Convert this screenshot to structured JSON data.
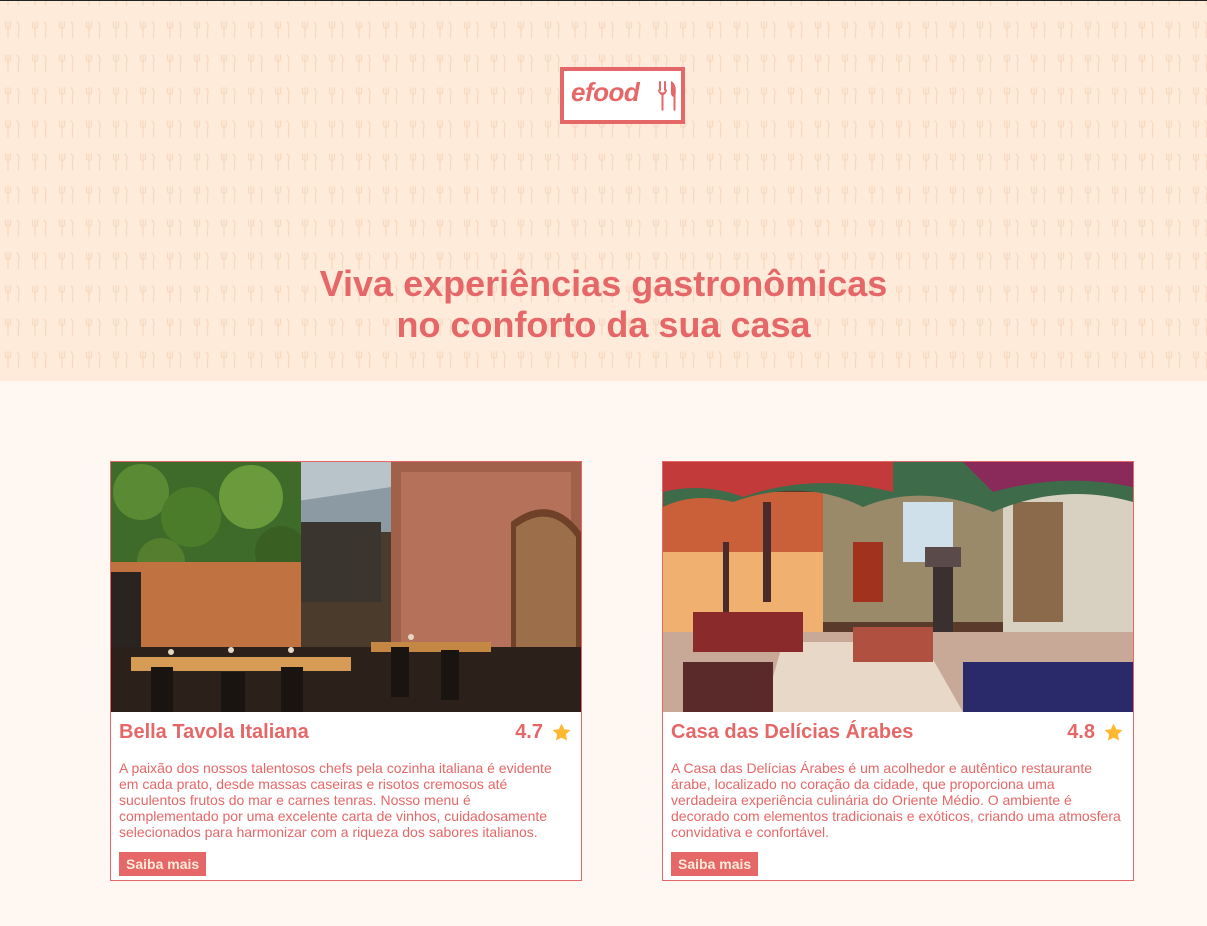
{
  "header": {
    "logo_text": "efood",
    "title_line1": "Viva experiências gastronômicas",
    "title_line2": "no conforto da sua casa"
  },
  "restaurants": [
    {
      "name": "Bella Tavola Italiana",
      "rating": "4.7",
      "description": "A paixão dos nossos talentosos chefs pela cozinha italiana é evidente em cada prato, desde massas caseiras e risotos cremosos até suculentos frutos do mar e carnes tenras. Nosso menu é complementado por uma excelente carta de vinhos, cuidadosamente selecionados para harmonizar com a riqueza dos sabores italianos.",
      "button_label": "Saiba mais"
    },
    {
      "name": "Casa das Delícias Árabes",
      "rating": "4.8",
      "description": "A Casa das Delícias Árabes é um acolhedor e autêntico restaurante árabe, localizado no coração da cidade, que proporciona uma verdadeira experiência culinária do Oriente Médio. O ambiente é decorado com elementos tradicionais e exóticos, criando uma atmosfera convidativa e confortável.",
      "button_label": "Saiba mais"
    }
  ],
  "colors": {
    "accent": "#E66767",
    "hero_bg": "#FFEBD9",
    "page_bg": "#FFF8F2",
    "star": "#FFB930"
  },
  "icons": {
    "logo": "fork-knife-icon",
    "rating": "star-icon"
  }
}
